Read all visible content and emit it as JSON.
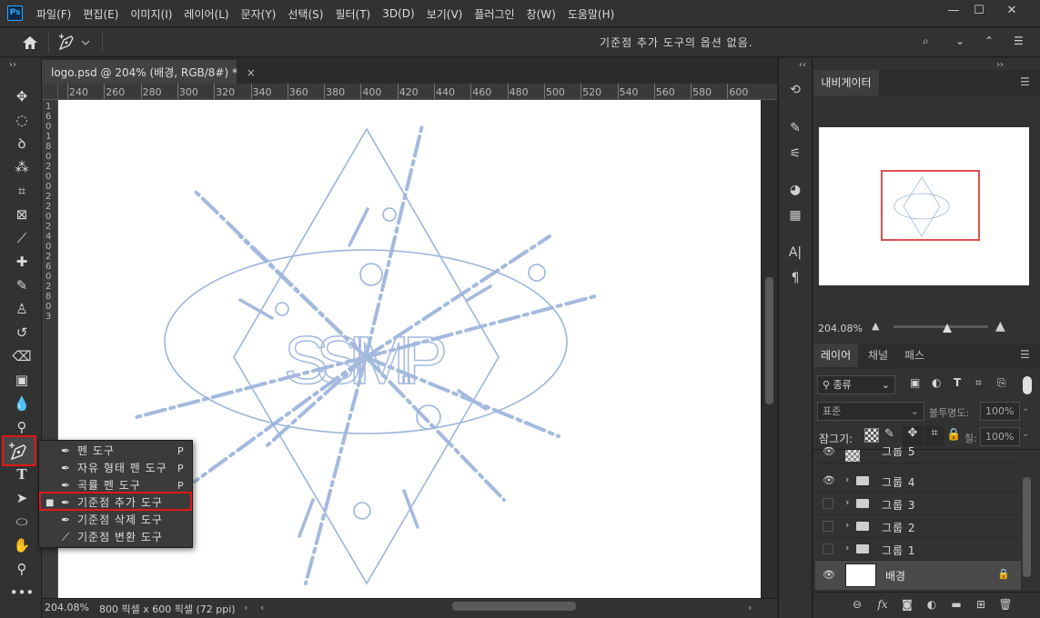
{
  "app": {
    "logo": "Ps",
    "menu": [
      "파일(F)",
      "편집(E)",
      "이미지(I)",
      "레이어(L)",
      "문자(Y)",
      "선택(S)",
      "필터(T)",
      "3D(D)",
      "보기(V)",
      "플러그인",
      "창(W)",
      "도움말(H)"
    ],
    "window_controls": {
      "minimize": "—",
      "maximize": "☐",
      "close": "✕"
    }
  },
  "options_bar": {
    "message": "기준점 추가 도구의 옵션 없음."
  },
  "document": {
    "tab_title": "logo.psd @ 204% (배경, RGB/8#) *",
    "tab_close": "×",
    "ruler_h": [
      "240",
      "260",
      "280",
      "300",
      "320",
      "340",
      "360",
      "380",
      "400",
      "420",
      "440",
      "460",
      "480",
      "500",
      "520",
      "540",
      "560",
      "580",
      "600"
    ],
    "ruler_v": [
      "1",
      "6",
      "0",
      "1",
      "8",
      "0",
      "2",
      "0",
      "0",
      "2",
      "2",
      "0",
      "2",
      "4",
      "0",
      "2",
      "6",
      "0",
      "2",
      "8",
      "0",
      "3"
    ],
    "logo_text": "SSIM.P",
    "status_zoom": "204.08%",
    "status_info": "800 픽셀 x 600 픽셀 (72 ppi)"
  },
  "flyout": [
    {
      "icon": "pen-icon",
      "label": "펜 도구",
      "shortcut": "P",
      "selected": false
    },
    {
      "icon": "freeform-pen-icon",
      "label": "자유 형태 펜 도구",
      "shortcut": "P",
      "selected": false
    },
    {
      "icon": "curvature-pen-icon",
      "label": "곡률 펜 도구",
      "shortcut": "P",
      "selected": false
    },
    {
      "icon": "add-anchor-point-icon",
      "label": "기준점 추가 도구",
      "shortcut": "",
      "selected": true
    },
    {
      "icon": "delete-anchor-point-icon",
      "label": "기준점 삭제 도구",
      "shortcut": "",
      "selected": false
    },
    {
      "icon": "convert-point-icon",
      "label": "기준점 변환 도구",
      "shortcut": "",
      "selected": false
    }
  ],
  "navigator": {
    "tab": "내비게이터",
    "zoom": "204.08%"
  },
  "layers_panel": {
    "tabs": [
      "레이어",
      "채널",
      "패스"
    ],
    "filter_label": "종류",
    "blend_mode": "표준",
    "opacity_label": "불투명도:",
    "opacity_value": "100%",
    "lock_label": "잠그기:",
    "fill_label": "칠:",
    "fill_value": "100%",
    "layers": [
      {
        "name": "그룹 5",
        "visible": true,
        "type": "partial"
      },
      {
        "name": "그룹 4",
        "visible": true,
        "type": "group"
      },
      {
        "name": "그룹 3",
        "visible": false,
        "type": "group"
      },
      {
        "name": "그룹 2",
        "visible": false,
        "type": "group"
      },
      {
        "name": "그룹 1",
        "visible": false,
        "type": "group"
      },
      {
        "name": "배경",
        "visible": true,
        "type": "background"
      }
    ],
    "footer_icons": [
      "link-icon",
      "fx-icon",
      "mask-icon",
      "adjustment-icon",
      "new-group-icon",
      "new-layer-icon",
      "delete-icon"
    ]
  },
  "colors": {
    "accent_red": "#e01818",
    "logo_blue": "#9cb4dc"
  }
}
